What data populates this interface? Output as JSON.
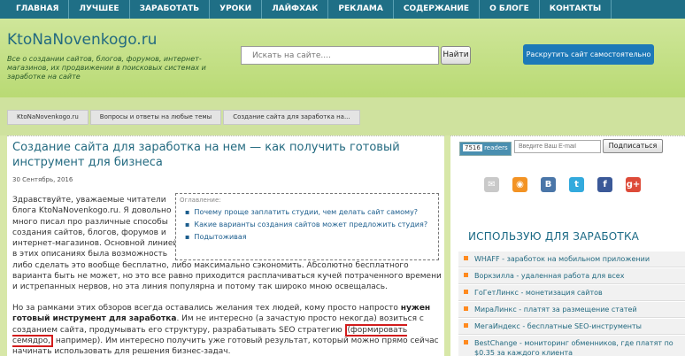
{
  "nav": [
    "ГЛАВНАЯ",
    "ЛУЧШЕЕ",
    "ЗАРАБОТАТЬ",
    "УРОКИ",
    "ЛАЙФХАК",
    "РЕКЛАМА",
    "СОДЕРЖАНИЕ",
    "О БЛОГЕ",
    "КОНТАКТЫ"
  ],
  "header": {
    "title": "KtoNaNovenkogo.ru",
    "description": "Все о создании сайтов, блогов, форумов, интернет-магазинов, их продвижении в поисковых системах и заработке на сайте",
    "search_placeholder": "Искать на сайте....",
    "search_button": "Найти",
    "promo_button": "Раскрутить сайт самостоятельно"
  },
  "breadcrumb": [
    "KtoNaNovenkogo.ru",
    "Вопросы и ответы на любые темы",
    "Создание сайта для заработка на..."
  ],
  "post": {
    "title": "Создание сайта для заработка на нем — как получить готовый инструмент для бизнеса",
    "date": "30 Сентябрь, 2016",
    "para1": "Здравствуйте, уважаемые читатели блога KtoNaNovenkogo.ru. Я довольно много писал про различные способы создания сайтов, блогов, форумов и интернет-магазинов. Основной линией в этих описаниях была возможность либо сделать это вообще бесплатно, либо максимально сэкономить. Абсолютно бесплатного варианта быть не может, но это все равно приходится расплачиваться кучей потраченного времени и истрепанных нервов, но эта линия популярна и потому так широко мною освещалась.",
    "para2_a": "Но за рамками этих обзоров всегда оставались желания тех людей, кому просто напросто ",
    "para2_bold": "нужен готовый инструмент для заработка",
    "para2_b": ". Им не интересно (а зачастую просто некогда) возиться с созданием сайта, продумывать его структуру, разрабатывать SEO стратегию ",
    "para2_highlight": "(формировать семядро,",
    "para2_c": " например). Им интересно получить уже готовый результат, который можно прямо сейчас начинать использовать для решения бизнес-задач."
  },
  "toc": {
    "title": "Оглавление:",
    "items": [
      "Почему проще заплатить студии, чем делать сайт самому?",
      "Какие варианты создания сайтов может предложить студия?",
      "Подытоживая"
    ]
  },
  "sidebar": {
    "readers_label": "readers",
    "readers_count": "7516",
    "email_placeholder": "Введите Ваш E-mail",
    "subscribe_button": "Подписаться",
    "social": [
      {
        "name": "email-icon",
        "glyph": "✉",
        "color": "#c9c9c9"
      },
      {
        "name": "rss-icon",
        "glyph": "◉",
        "color": "#f39324"
      },
      {
        "name": "vk-icon",
        "glyph": "В",
        "color": "#4a76a8"
      },
      {
        "name": "twitter-icon",
        "glyph": "t",
        "color": "#33aadd"
      },
      {
        "name": "facebook-icon",
        "glyph": "f",
        "color": "#3b5998"
      },
      {
        "name": "gplus-icon",
        "glyph": "g+",
        "color": "#dd4b39"
      }
    ],
    "heading": "ИСПОЛЬЗУЮ ДЛЯ ЗАРАБОТКА",
    "links": [
      "WHAFF - заработок на мобильном приложении",
      "Воркзилла - удаленная работа для всех",
      "ГоГетЛинкс - монетизация сайтов",
      "МираЛинкс - платят за размещение статей",
      "МегаИндекс - бесплатные SEO-инструменты",
      "BestChange - мониторинг обменников, где платят по $0.35 за каждого клиента"
    ]
  }
}
